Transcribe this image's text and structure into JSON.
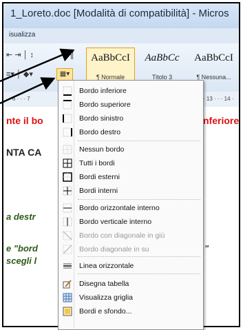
{
  "window": {
    "title": "1_Loreto.doc [Modalità di compatibilità] - Micros"
  },
  "tabs": {
    "visible_label": "isualizza"
  },
  "styles": [
    {
      "sample": "AaBbCcI",
      "label": "¶ Normale",
      "selected": true,
      "italic": false
    },
    {
      "sample": "AaBbCc",
      "label": "Titolo 3",
      "selected": false,
      "italic": true
    },
    {
      "sample": "AaBbCcI",
      "label": "¶ Nessuna...",
      "selected": false,
      "italic": false
    }
  ],
  "ruler": {
    "left_text": "· 6 · · · 7",
    "right_text": "· 13 · · · 14 ·"
  },
  "document": {
    "line1_left": "nte il ",
    "line1_partial": "bo",
    "line1_right": "nferiore:",
    "line2": "NTA CA",
    "line3": "a destr",
    "line4": "e \"bord",
    "line4_right": "\"",
    "line5": "scegli l"
  },
  "menu": [
    {
      "label": "Bordo inferiore",
      "icon": "border-bottom-icon",
      "enabled": true
    },
    {
      "label": "Bordo superiore",
      "icon": "border-top-icon",
      "enabled": true
    },
    {
      "label": "Bordo sinistro",
      "icon": "border-left-icon",
      "enabled": true
    },
    {
      "label": "Bordo destro",
      "icon": "border-right-icon",
      "enabled": true
    },
    {
      "label": "Nessun bordo",
      "icon": "no-border-icon",
      "enabled": true
    },
    {
      "label": "Tutti i bordi",
      "icon": "all-borders-icon",
      "enabled": true
    },
    {
      "label": "Bordi esterni",
      "icon": "outside-borders-icon",
      "enabled": true
    },
    {
      "label": "Bordi interni",
      "icon": "inside-borders-icon",
      "enabled": true
    },
    {
      "label": "Bordo orizzontale interno",
      "icon": "inside-horizontal-border-icon",
      "enabled": true
    },
    {
      "label": "Bordo verticale interno",
      "icon": "inside-vertical-border-icon",
      "enabled": true
    },
    {
      "label": "Bordo con diagonale in giù",
      "icon": "diagonal-down-border-icon",
      "enabled": false
    },
    {
      "label": "Bordo diagonale in su",
      "icon": "diagonal-up-border-icon",
      "enabled": false
    },
    {
      "label": "Linea orizzontale",
      "icon": "horizontal-line-icon",
      "enabled": true
    },
    {
      "label": "Disegna tabella",
      "icon": "draw-table-icon",
      "enabled": true
    },
    {
      "label": "Visualizza griglia",
      "icon": "view-gridlines-icon",
      "enabled": true
    },
    {
      "label": "Bordi e sfondo...",
      "icon": "borders-shading-icon",
      "enabled": true
    }
  ],
  "annotations": [
    {
      "name": "arrow-to-pilcrow"
    },
    {
      "name": "arrow-to-border-button"
    }
  ]
}
